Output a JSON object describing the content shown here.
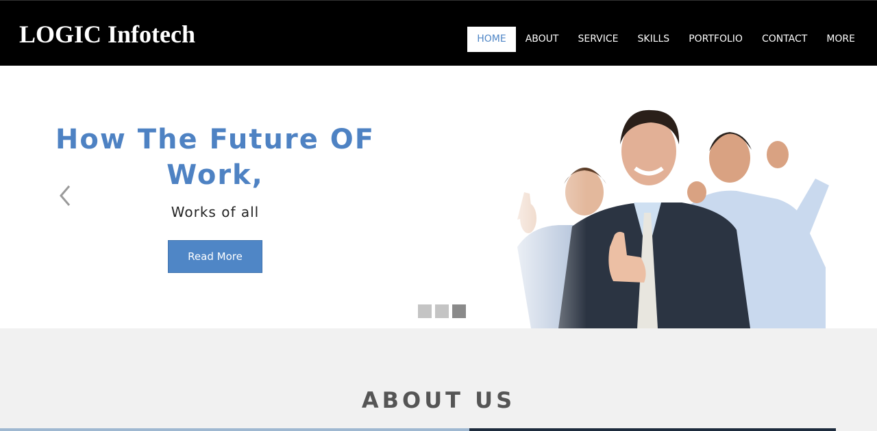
{
  "brand": {
    "name": "LOGIC Infotech"
  },
  "nav": {
    "items": [
      {
        "label": "HOME",
        "active": true
      },
      {
        "label": "ABOUT",
        "active": false
      },
      {
        "label": "SERVICE",
        "active": false
      },
      {
        "label": "SKILLS",
        "active": false
      },
      {
        "label": "PORTFOLIO",
        "active": false
      },
      {
        "label": "CONTACT",
        "active": false
      },
      {
        "label": "MORE",
        "active": false
      }
    ]
  },
  "hero": {
    "title_line1": "How The Future OF",
    "title_line2": "Work,",
    "subtitle": "Works of all",
    "cta_label": "Read More",
    "prev_icon": "chevron-left-icon",
    "next_icon": "chevron-right-icon",
    "slide_count": 3,
    "active_slide": 3
  },
  "about": {
    "title": "ABOUT US"
  },
  "colors": {
    "accent": "#4f86c6",
    "header_bg": "#000000",
    "section_bg": "#f1f1f1"
  }
}
